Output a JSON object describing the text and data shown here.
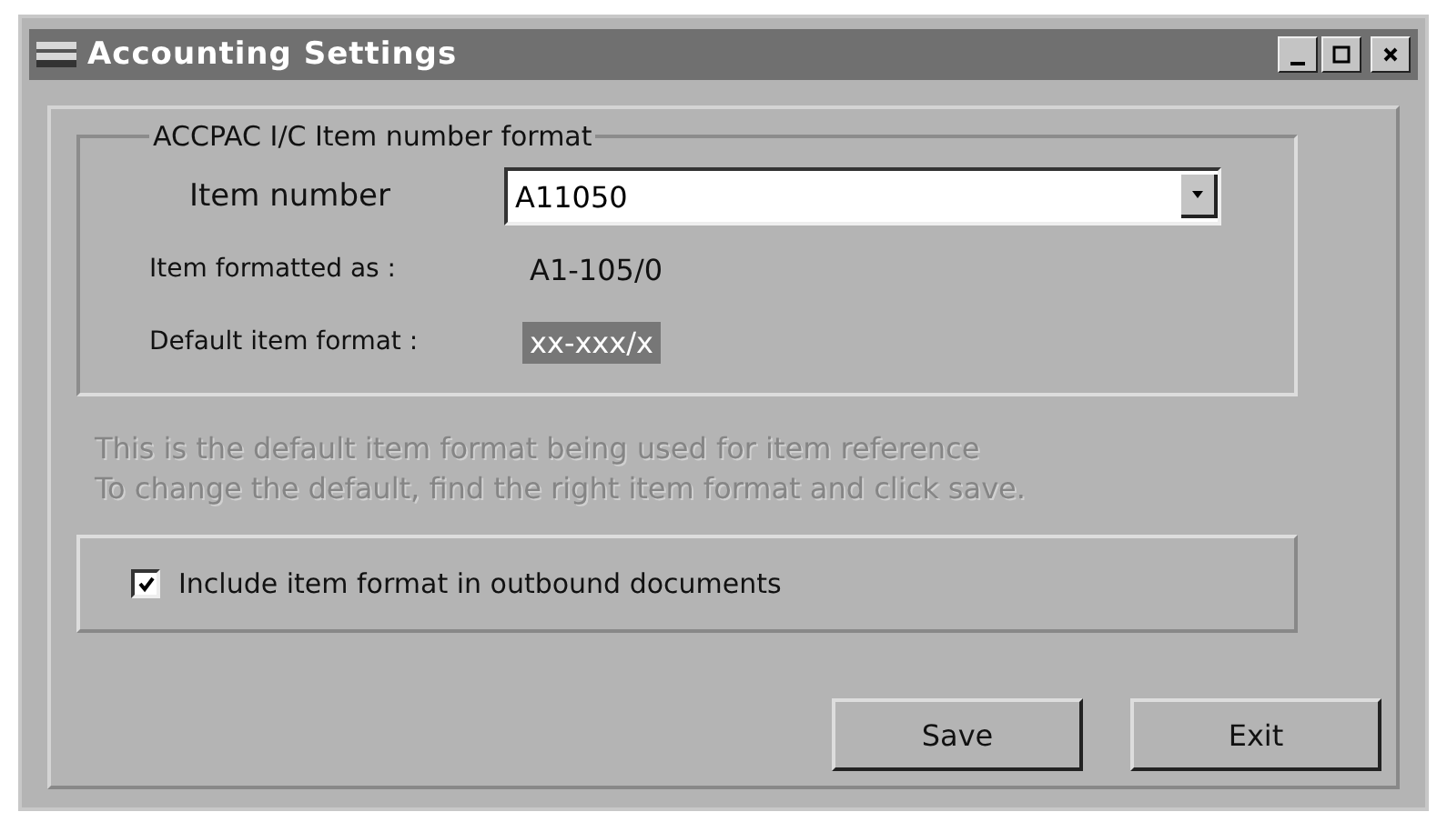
{
  "window": {
    "title": "Accounting Settings"
  },
  "group": {
    "title": "ACCPAC I/C Item number format",
    "item_number": {
      "label": "Item number",
      "value": "A11050"
    },
    "formatted": {
      "label": "Item formatted as :",
      "value": "A1-105/0"
    },
    "default_format": {
      "label": "Default item format :",
      "value": "xx-xxx/x",
      "selected": true
    }
  },
  "info": [
    "This is the default item format being used for item reference",
    "To change the default, find the right item format and click save."
  ],
  "include_option": {
    "label": "Include item format in outbound documents",
    "checked": true
  },
  "buttons": [
    "Save",
    "Exit"
  ]
}
